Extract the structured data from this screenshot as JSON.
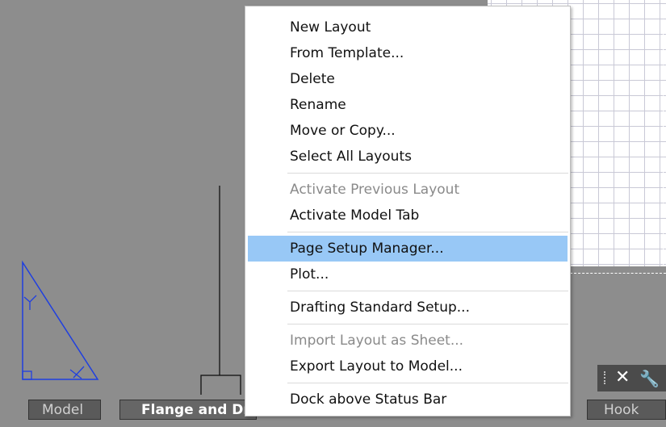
{
  "context_menu": {
    "items": [
      {
        "label": "New Layout"
      },
      {
        "label": "From Template..."
      },
      {
        "label": "Delete"
      },
      {
        "label": "Rename"
      },
      {
        "label": "Move or Copy..."
      },
      {
        "label": "Select All Layouts"
      },
      {
        "label": "Activate Previous Layout",
        "disabled": true
      },
      {
        "label": "Activate Model Tab"
      },
      {
        "label": "Page Setup Manager...",
        "highlighted": true
      },
      {
        "label": "Plot..."
      },
      {
        "label": "Drafting Standard Setup..."
      },
      {
        "label": "Import Layout as Sheet...",
        "disabled": true
      },
      {
        "label": "Export Layout to Model..."
      },
      {
        "label": "Dock above Status Bar"
      }
    ]
  },
  "tabs": {
    "model": "Model",
    "flange": "Flange and Dr",
    "hook": "Hook"
  },
  "mini_toolbar": {
    "close_icon": "close-icon",
    "wrench_icon": "wrench-icon"
  },
  "colors": {
    "background": "#8d8d8d",
    "highlight": "#98c8f6",
    "drawing_blue": "#1f3fe0"
  }
}
